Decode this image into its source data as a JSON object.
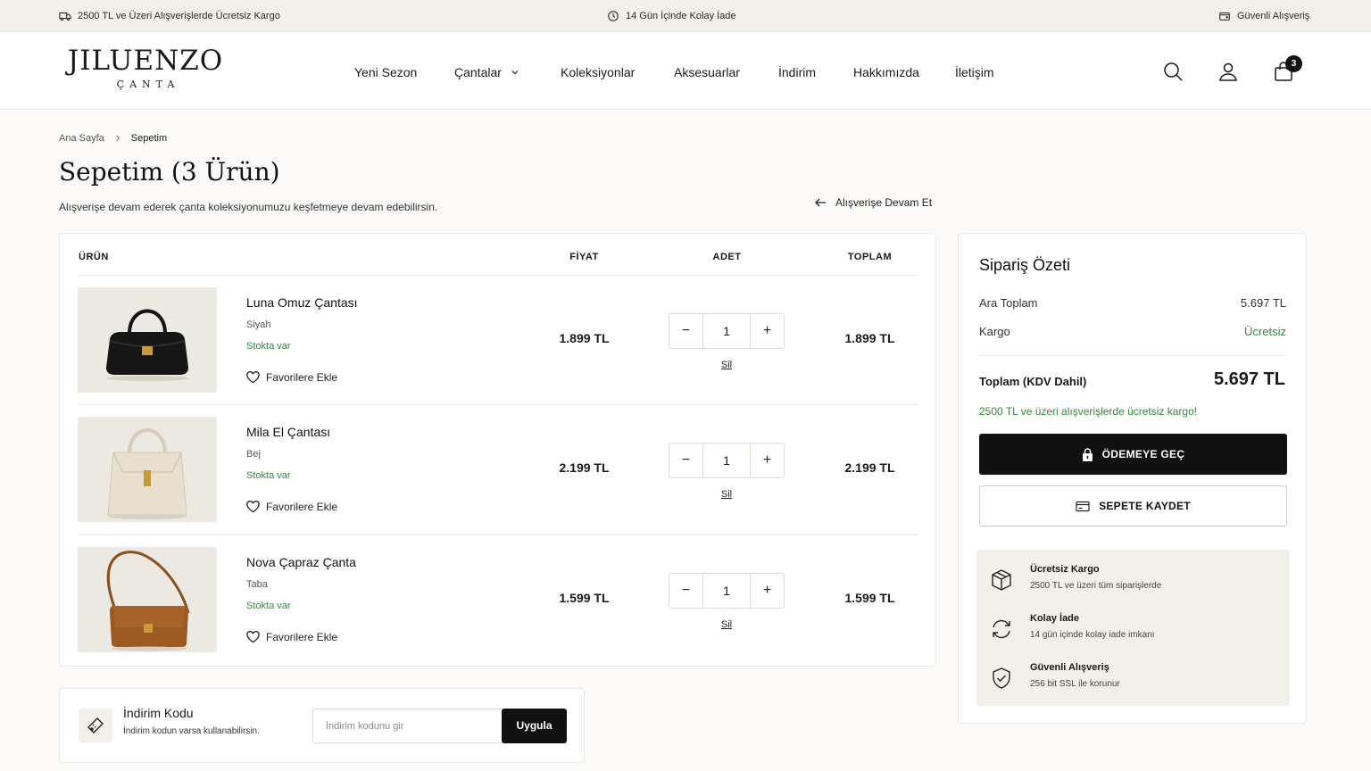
{
  "topbar": {
    "shipping": "2500 TL ve Üzeri Alışverişlerde Ücretsiz Kargo",
    "returns": "14 Gün İçinde Kolay İade",
    "secure": "Güvenli Alışveriş"
  },
  "brand": {
    "name": "JILUENZO",
    "sub": "ÇANTA"
  },
  "nav": {
    "items": [
      "Yeni Sezon",
      "Çantalar",
      "Koleksiyonlar",
      "Aksesuarlar",
      "İndirim",
      "Hakkımızda",
      "İletişim"
    ]
  },
  "header": {
    "cart_count": "3",
    "icons": [
      "search-icon",
      "user-icon",
      "bag-icon"
    ]
  },
  "breadcrumb": {
    "home": "Ana Sayfa",
    "current": "Sepetim"
  },
  "page": {
    "title": "Sepetim",
    "count": "(3 Ürün)",
    "subtitle": "Alışverişe devam ederek çanta koleksiyonumuzu keşfetmeye devam edebilirsin.",
    "continue": "Alışverişe Devam Et"
  },
  "cart": {
    "headers": {
      "product": "ÜRÜN",
      "price": "FİYAT",
      "qty": "ADET",
      "total": "TOPLAM"
    },
    "favorite_label": "Favorilere Ekle",
    "remove_label": "Sil",
    "items": [
      {
        "name": "Luna Omuz Çantası",
        "color": "Siyah",
        "stock": "Stokta var",
        "price": "1.899 TL",
        "qty": "1",
        "total": "1.899 TL",
        "swatch": "#141414"
      },
      {
        "name": "Mila El Çantası",
        "color": "Bej",
        "stock": "Stokta var",
        "price": "2.199 TL",
        "qty": "1",
        "total": "2.199 TL",
        "swatch": "#e6dccb"
      },
      {
        "name": "Nova Çapraz Çanta",
        "color": "Taba",
        "stock": "Stokta var",
        "price": "1.599 TL",
        "qty": "1",
        "total": "1.599 TL",
        "swatch": "#9a5a22"
      }
    ]
  },
  "discount": {
    "title": "İndirim Kodu",
    "subtitle": "İndirim kodun varsa kullanabilirsin.",
    "placeholder": "İndirim kodunu gir",
    "apply": "Uygula"
  },
  "summary": {
    "title": "Sipariş Özeti",
    "subtotal_label": "Ara Toplam",
    "subtotal": "5.697 TL",
    "shipping_label": "Kargo",
    "shipping": "Ücretsiz",
    "total_label": "Toplam (KDV Dahil)",
    "total": "5.697 TL",
    "note": "2500 TL ve üzeri alışverişlerde ücretsiz kargo!",
    "pay": "ÖDEMEYE GEÇ",
    "save": "SEPETE KAYDET",
    "perks": [
      {
        "title": "Ücretsiz Kargo",
        "sub": "2500 TL ve üzeri tüm siparişlerde"
      },
      {
        "title": "Kolay İade",
        "sub": "14 gün içinde kolay iade imkanı"
      },
      {
        "title": "Güvenli Alışveriş",
        "sub": "256 bit SSL ile korunur"
      }
    ]
  },
  "colors": {
    "accent": "#111111",
    "success": "#2f8a3a",
    "cream": "#f2eee8"
  }
}
